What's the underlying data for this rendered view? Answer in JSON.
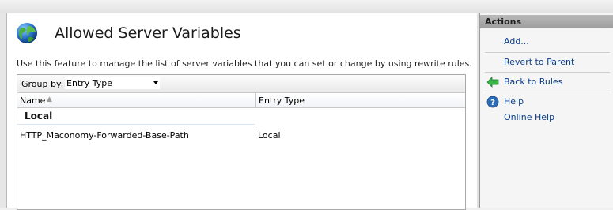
{
  "page": {
    "title": "Allowed Server Variables",
    "description": "Use this feature to manage the list of server variables that you can set or change by using rewrite rules."
  },
  "groupby": {
    "label": "Group by:",
    "value": "Entry Type"
  },
  "columns": {
    "name": "Name",
    "entry_type": "Entry Type"
  },
  "groups": [
    {
      "label": "Local",
      "rows": [
        {
          "name": "HTTP_Maconomy-Forwarded-Base-Path",
          "entry_type": "Local"
        }
      ]
    }
  ],
  "actions": {
    "title": "Actions",
    "items": [
      {
        "label": "Add...",
        "icon": "none"
      },
      {
        "label": "Revert to Parent",
        "icon": "none"
      },
      {
        "label": "Back to Rules",
        "icon": "back-arrow-icon"
      },
      {
        "label": "Help",
        "icon": "help-icon"
      },
      {
        "label": "Online Help",
        "icon": "none"
      }
    ]
  },
  "colors": {
    "link": "#0b3e8a",
    "action_header": "#a8a8a8",
    "back_arrow": "#39b54a",
    "help": "#2b6cb8"
  }
}
